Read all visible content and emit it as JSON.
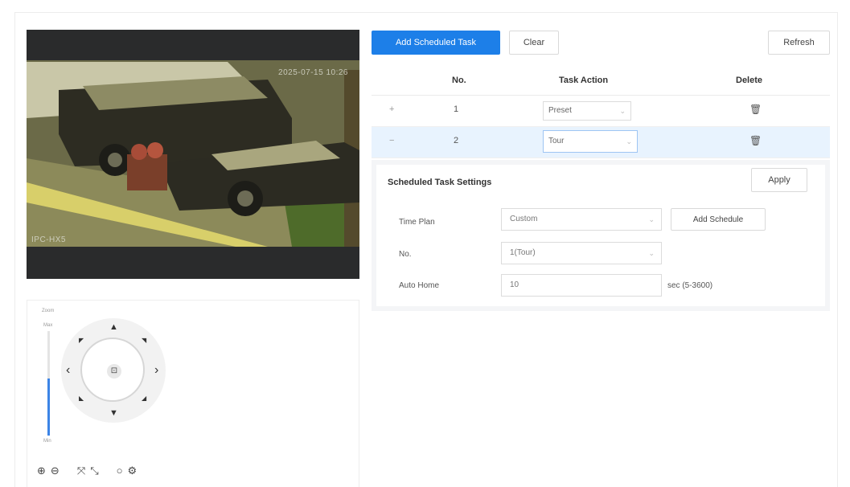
{
  "video": {
    "timestamp": "2025-07-15 10:26",
    "camera_label": "IPC-HX5"
  },
  "ptz": {
    "slider_top": "Zoom",
    "slider_max": "Max",
    "slider_min": "Min",
    "slider_level": 0.55,
    "center": "⊡",
    "arrows": {
      "up": "▲",
      "down": "▼",
      "left": "‹",
      "right": "›",
      "ul": "◤",
      "ur": "◥",
      "dl": "◣",
      "dr": "◢"
    },
    "zoom_in": "⊕",
    "zoom_out": "⊖",
    "focus_near": "⤧",
    "focus_far": "⤡",
    "iris_open": "○",
    "iris_close": "⚙"
  },
  "toolbar": {
    "add_label": "Add Scheduled Task",
    "clear_label": "Clear",
    "refresh_label": "Refresh"
  },
  "table": {
    "headers": {
      "no": "No.",
      "action": "Task Action",
      "delete": "Delete"
    },
    "rows": [
      {
        "toggle": "+",
        "no": "1",
        "action": "Preset",
        "delete_icon": "trash-icon"
      },
      {
        "toggle": "−",
        "no": "2",
        "action": "Tour",
        "delete_icon": "trash-icon"
      }
    ]
  },
  "settings": {
    "title": "Scheduled Task Settings",
    "apply_label": "Apply",
    "time_plan_label": "Time Plan",
    "time_plan_value": "Custom",
    "add_schedule_label": "Add Schedule",
    "no_label": "No.",
    "no_value": "1(Tour)",
    "auto_home_label": "Auto Home",
    "auto_home_value": "10",
    "auto_home_unit": "sec (5-3600)"
  },
  "colors": {
    "accent": "#1d7fe8",
    "selected_row": "#e8f3fe"
  }
}
